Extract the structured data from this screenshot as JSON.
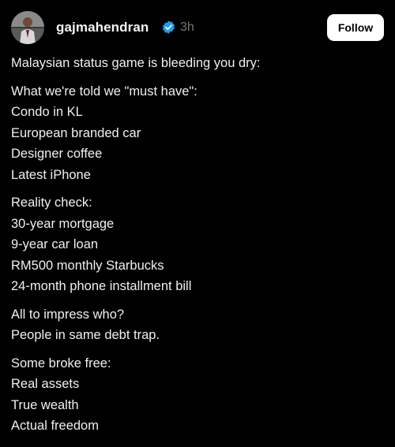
{
  "post": {
    "username": "gajmahendran",
    "timestamp": "3h",
    "follow_label": "Follow",
    "verified_icon": "verified-badge-icon",
    "colors": {
      "background": "#000000",
      "text": "#f0f0f0",
      "muted": "#777777",
      "verified": "#1d9bf0",
      "button_bg": "#ffffff"
    },
    "intro": "Malaysian status game is bleeding you dry:",
    "sections": [
      {
        "lines": [
          "What we're told we \"must have\":",
          "Condo in KL",
          "European branded car",
          "Designer coffee",
          "Latest iPhone"
        ]
      },
      {
        "lines": [
          "Reality check:",
          "30-year mortgage",
          "9-year car loan",
          "RM500 monthly Starbucks",
          "24-month phone installment bill"
        ]
      },
      {
        "lines": [
          "All to impress who?",
          "People in same debt trap."
        ]
      },
      {
        "lines": [
          "Some broke free:",
          "Real assets",
          "True wealth",
          "Actual freedom"
        ]
      }
    ]
  }
}
